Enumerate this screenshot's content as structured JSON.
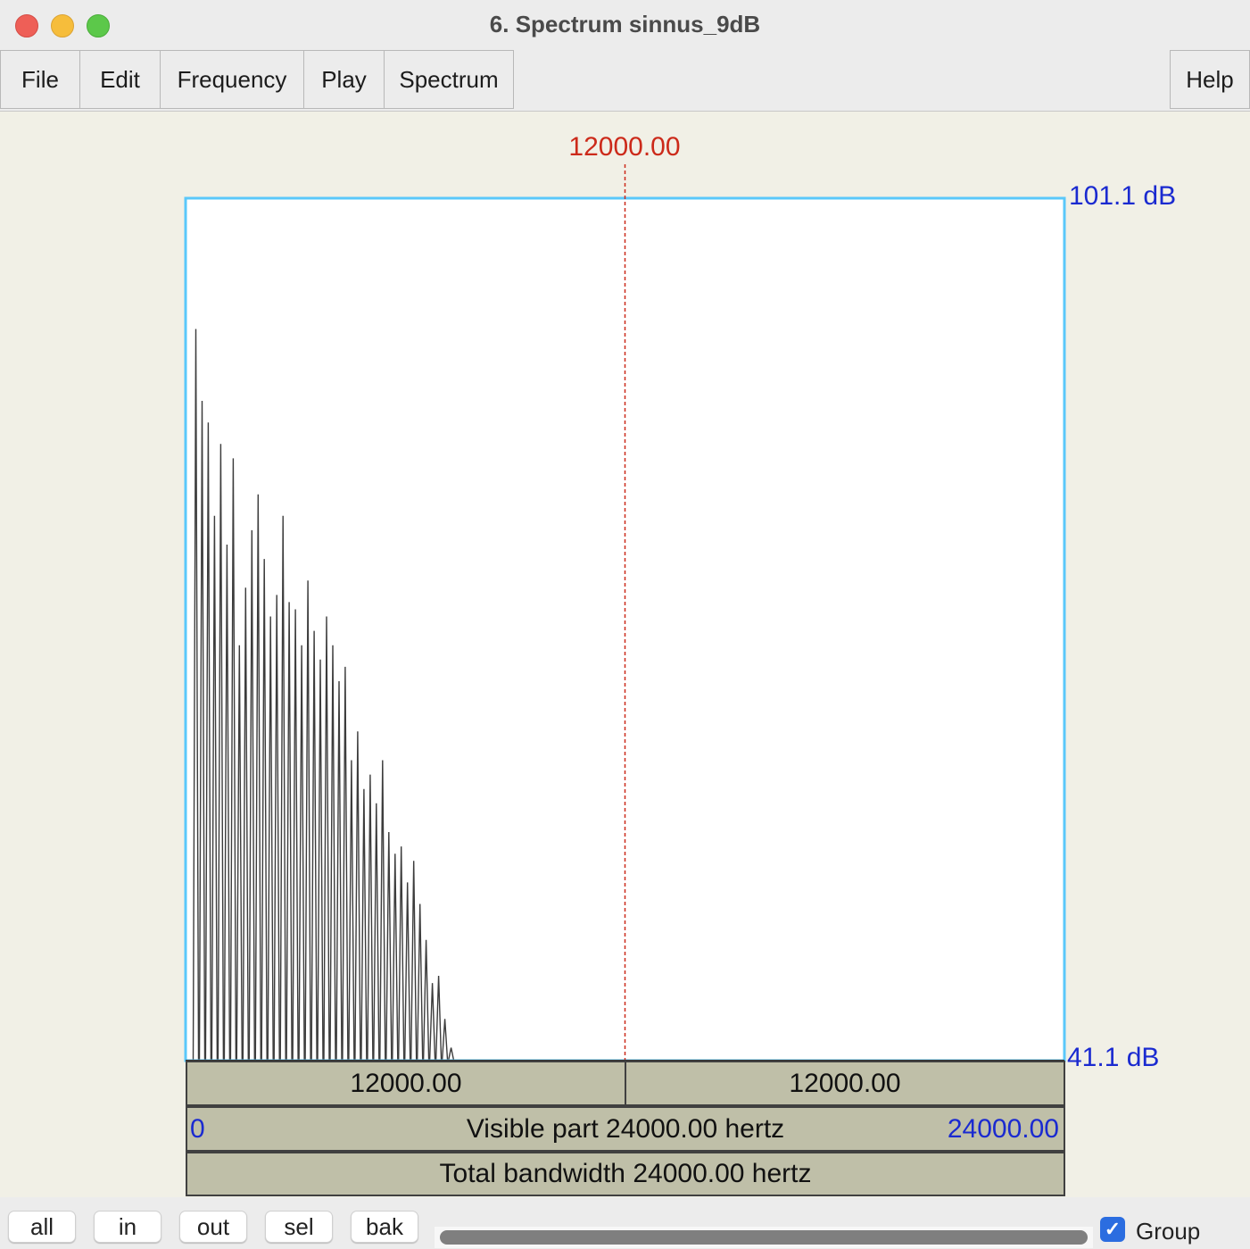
{
  "window": {
    "title": "6. Spectrum sinnus_9dB"
  },
  "menu": {
    "file": "File",
    "edit": "Edit",
    "frequency": "Frequency",
    "play": "Play",
    "spectrum": "Spectrum",
    "help": "Help"
  },
  "plot": {
    "cursor_label": "12000.00",
    "ymax_label": "101.1 dB",
    "ymin_label": "41.1 dB",
    "left_interval": "12000.00",
    "right_interval": "12000.00",
    "visible_start": "0",
    "visible_text": "Visible part 24000.00 hertz",
    "visible_end": "24000.00",
    "total_text": "Total bandwidth 24000.00 hertz",
    "colors": {
      "spectrum": "#3c3c3c",
      "frame": "#5ac8fa",
      "cursor": "#cc2a1a",
      "axis_labels": "#1a2ad0"
    }
  },
  "chart_data": {
    "type": "line",
    "xlabel": "",
    "ylabel": "",
    "xlim": [
      0,
      24000
    ],
    "ylim": [
      41.1,
      101.1
    ],
    "cursor_x": 12000,
    "peaks_x": [
      280,
      450,
      620,
      790,
      960,
      1130,
      1300,
      1470,
      1640,
      1810,
      1980,
      2150,
      2320,
      2490,
      2660,
      2830,
      3000,
      3170,
      3340,
      3510,
      3680,
      3850,
      4020,
      4190,
      4360,
      4530,
      4700,
      4870,
      5040,
      5210,
      5380,
      5550,
      5720,
      5890,
      6060,
      6230,
      6400,
      6570,
      6740,
      6910,
      7080,
      7250
    ],
    "peaks_y": [
      92.0,
      87.0,
      85.5,
      79.0,
      84.0,
      77.0,
      83.0,
      70.0,
      74.0,
      78.0,
      80.5,
      76.0,
      72.0,
      73.5,
      79.0,
      73.0,
      72.5,
      70.0,
      74.5,
      71.0,
      69.0,
      72.0,
      70.0,
      67.5,
      68.5,
      62.0,
      64.0,
      60.0,
      61.0,
      59.0,
      62.0,
      57.0,
      55.5,
      56.0,
      53.5,
      55.0,
      52.0,
      49.5,
      46.5,
      47.0,
      44.0,
      42.0
    ],
    "baseline": 41.1
  },
  "bottom": {
    "all": "all",
    "in": "in",
    "out": "out",
    "sel": "sel",
    "bak": "bak",
    "group_label": "Group",
    "group_checked": true
  }
}
